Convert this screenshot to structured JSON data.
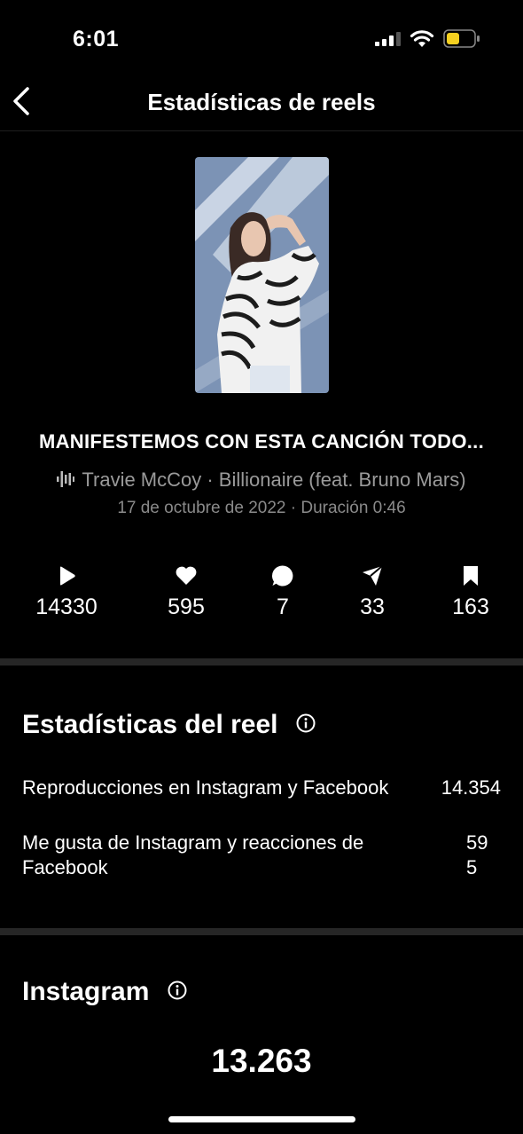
{
  "status_bar": {
    "time": "6:01"
  },
  "header": {
    "title": "Estadísticas de reels"
  },
  "reel": {
    "caption": "MANIFESTEMOS CON ESTA CANCIÓN TODO...",
    "audio": "Travie McCoy · Billionaire (feat. Bruno Mars)",
    "meta": "17 de octubre de 2022 · Duración 0:46"
  },
  "stats": [
    {
      "icon": "play-icon",
      "value": "14330"
    },
    {
      "icon": "heart-icon",
      "value": "595"
    },
    {
      "icon": "comment-icon",
      "value": "7"
    },
    {
      "icon": "share-icon",
      "value": "33"
    },
    {
      "icon": "bookmark-icon",
      "value": "163"
    }
  ],
  "reel_stats": {
    "title": "Estadísticas del reel",
    "rows": [
      {
        "label": "Reproducciones en Instagram y Facebook",
        "value": "14.354"
      },
      {
        "label_line1": "Me gusta de Instagram y reacciones de",
        "label_line2": "Facebook",
        "value_line1": "59",
        "value_line2": "5"
      }
    ]
  },
  "instagram": {
    "title": "Instagram",
    "value": "13.263"
  }
}
